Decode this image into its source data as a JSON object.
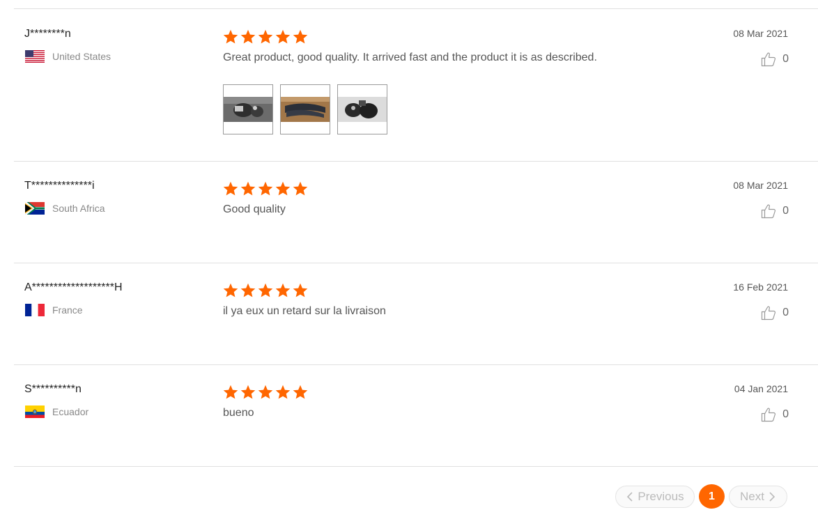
{
  "reviews": [
    {
      "user": "J********n",
      "country": "United States",
      "flag_icon": "us-flag-icon",
      "rating": 5,
      "text": "Great product, good quality. It arrived fast and the product it is as described.",
      "date": "08 Mar 2021",
      "helpful_count": "0",
      "photo_count": 3
    },
    {
      "user": "T**************i",
      "country": "South Africa",
      "flag_icon": "za-flag-icon",
      "rating": 5,
      "text": "Good quality",
      "date": "08 Mar 2021",
      "helpful_count": "0"
    },
    {
      "user": "A*******************H",
      "country": "France",
      "flag_icon": "fr-flag-icon",
      "rating": 5,
      "text": "il ya eux un retard sur la livraison",
      "date": "16 Feb 2021",
      "helpful_count": "0"
    },
    {
      "user": "S**********n",
      "country": "Ecuador",
      "flag_icon": "ec-flag-icon",
      "rating": 5,
      "text": "bueno",
      "date": "04 Jan 2021",
      "helpful_count": "0"
    }
  ],
  "pagination": {
    "previous_label": "Previous",
    "current_page": "1",
    "next_label": "Next"
  },
  "colors": {
    "star": "#ff6600",
    "active_page": "#ff6600",
    "divider": "#e0e0e0"
  }
}
